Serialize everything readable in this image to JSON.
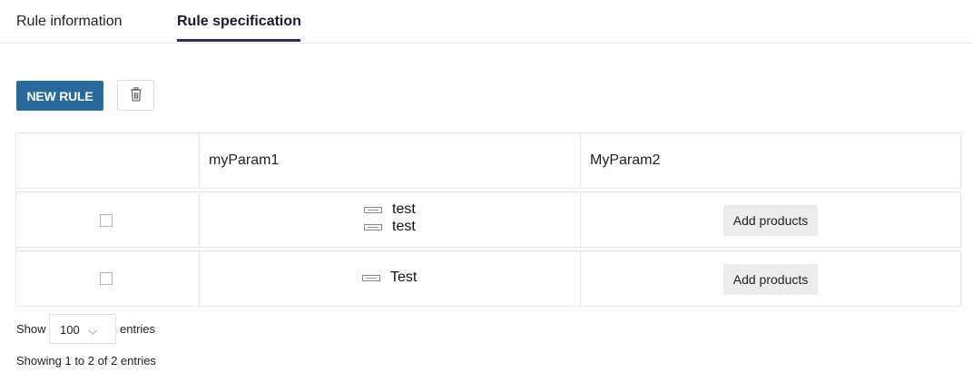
{
  "tabs": [
    {
      "label": "Rule information",
      "active": false
    },
    {
      "label": "Rule specification",
      "active": true
    }
  ],
  "toolbar": {
    "new_rule_label": "NEW RULE",
    "delete_icon": "trash-icon",
    "accent_color": "#276a9b"
  },
  "table": {
    "columns": [
      "",
      "myParam1",
      "MyParam2"
    ],
    "rows": [
      {
        "checked": false,
        "values": [
          "test",
          "test"
        ],
        "action_label": "Add products"
      },
      {
        "checked": false,
        "values": [
          "Test"
        ],
        "action_label": "Add products"
      }
    ]
  },
  "footer": {
    "show_label": "Show",
    "page_size": "100",
    "entries_label": "entries",
    "info": "Showing 1 to 2 of 2 entries"
  }
}
